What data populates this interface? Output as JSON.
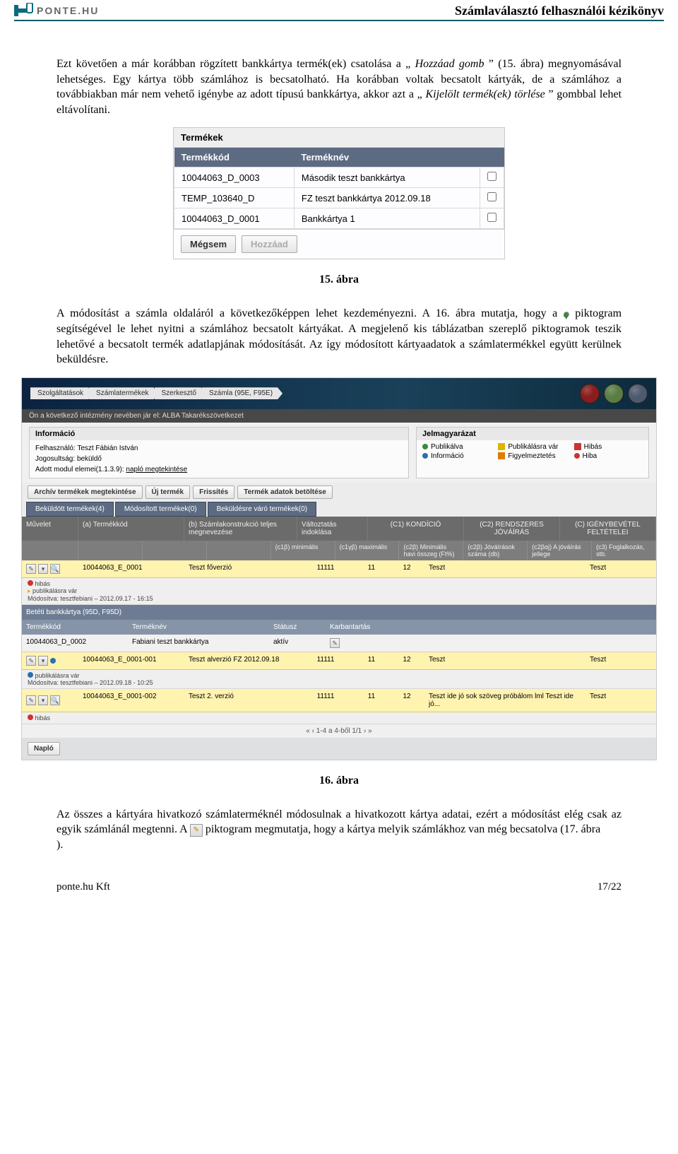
{
  "header": {
    "logo_text": "PONTE.HU",
    "doc_title": "Számlaválasztó felhasználói kézikönyv"
  },
  "para1_a": "Ezt követően a már korábban rögzített bankkártya termék(ek) csatolása a „",
  "para1_italic": "Hozzáad gomb",
  "para1_b": "” (15. ábra) megnyomásával lehetséges. Egy kártya több számlához is becsatolható. Ha korábban voltak becsatolt kártyák, de a számlához a továbbiakban már nem vehető igénybe az adott típusú bankkártya, akkor azt a „",
  "para1_italic2": "Kijelölt termék(ek) törlése",
  "para1_c": "” gombbal lehet eltávolítani.",
  "termekek": {
    "title": "Termékek",
    "col_code": "Termékkód",
    "col_name": "Terméknév",
    "rows": [
      {
        "code": "10044063_D_0003",
        "name": "Második teszt bankkártya"
      },
      {
        "code": "TEMP_103640_D",
        "name": "FZ teszt bankkártya 2012.09.18"
      },
      {
        "code": "10044063_D_0001",
        "name": "Bankkártya 1"
      }
    ],
    "btn_cancel": "Mégsem",
    "btn_add": "Hozzáad"
  },
  "fig15": "15. ábra",
  "para2_a": "A módosítást a számla oldaláról a következőképpen lehet kezdeményezni. A 16. ábra mutatja, hogy a ",
  "para2_b": " piktogram segítségével le lehet nyitni a számlához becsatolt kártyákat. A megjelenő kis táblázatban szereplő piktogramok teszik lehetővé a becsatolt termék adatlapjának módosítását. Az így módosított kártyaadatok a számlatermékkel együtt kerülnek beküldésre.",
  "app": {
    "breadcrumbs": [
      "Szolgáltatások",
      "Számlatermékek",
      "Szerkesztő",
      "Számla (95E, F95E)"
    ],
    "sub_banner": "Ön a következő intézmény nevében jár el: ALBA Takarékszövetkezet",
    "info_head": "Információ",
    "info_user_label": "Felhasználó:",
    "info_user": "Teszt Fábián István",
    "info_role_label": "Jogosultság:",
    "info_role": "beküldő",
    "info_module_label": "Adott modul elemei(1.1.3.9):",
    "info_module_link": "napló megtekintése",
    "legend_head": "Jelmagyarázat",
    "legend": [
      {
        "color": "#3a8a3a",
        "label": "Publikálva"
      },
      {
        "color": "#e0b400",
        "shape": "flag",
        "label": "Publikálásra vár"
      },
      {
        "color": "#c33",
        "shape": "flag",
        "label": "Hibás"
      },
      {
        "color": "#2a6fb5",
        "label": "Információ"
      },
      {
        "color": "#e07b00",
        "shape": "tri",
        "label": "Figyelmeztetés"
      },
      {
        "color": "#c33",
        "label": "Hiba"
      }
    ],
    "action_buttons": [
      "Archív termékek megtekintése",
      "Új termék",
      "Frissítés",
      "Termék adatok betöltése"
    ],
    "tabs": [
      "Beküldött termékek(4)",
      "Módosított termékek(0)",
      "Beküldésre váró termékek(0)"
    ],
    "grid_head1": {
      "muvelet": "Művelet",
      "a": "(a) Termékkód",
      "b": "(b) Számlakonstrukció teljes megnevezése",
      "valt": "Változtatás indoklása",
      "group1": "(C1) KONDÍCIÓ",
      "group2": "(C2) RENDSZERES JÓVÁÍRÁS",
      "group3": "(C) IGÉNYBEVÉTEL FELTÉTELEI"
    },
    "grid_head2": [
      "(c1β) minimális",
      "(c1γβ) maximális",
      "(c2β) Minimális havi összeg (Ft%)",
      "(c2β) Jóváírások száma (db)",
      "(c2βαj) A jóváírás jellege",
      "(c3) Foglalkozás, stb."
    ],
    "products": [
      {
        "code": "10044063_E_0001",
        "name": "Teszt főverzió",
        "v": "11111",
        "n1": "11",
        "n2": "12",
        "t1": "Teszt",
        "t2": "Teszt",
        "status": "hibás",
        "status_color": "#c33",
        "status2": "publikálásra vár",
        "status_note": "Módosítva: tesztfebiani – 2012.09.17 - 16:15"
      }
    ],
    "sub_header": "Betéti bankkártya (95D, F95D)",
    "sub_cols": [
      "Termékkód",
      "Terméknév",
      "Státusz",
      "Karbantartás"
    ],
    "sub_row": {
      "code": "10044063_D_0002",
      "name": "Fabiani teszt bankkártya",
      "status": "aktív"
    },
    "products2": [
      {
        "code": "10044063_E_0001-001",
        "name": "Teszt alverzió FZ 2012.09.18",
        "v": "11111",
        "n1": "11",
        "n2": "12",
        "t1": "Teszt",
        "t2": "Teszt",
        "status": "publikálásra vár",
        "status_color": "#e0b400",
        "status_note": "Módosítva: tesztfebiani – 2012.09.18 - 10:25"
      },
      {
        "code": "10044063_E_0001-002",
        "name": "Teszt 2. verzió",
        "v": "11111",
        "n1": "11",
        "n2": "12",
        "t1": "Teszt ide jó sok szöveg próbálom lml Teszt ide jó...",
        "t2": "Teszt",
        "status": "hibás",
        "status_color": "#c33"
      }
    ],
    "pager": "1-4 a 4-ből   1/1",
    "naplo": "Napló"
  },
  "fig16": "16. ábra",
  "para3_a": "Az összes a kártyára hivatkozó számlaterméknél módosulnak a hivatkozott kártya adatai, ezért a módosítást elég csak az egyik számlánál megtenni. A ",
  "para3_b": " piktogram megmutatja, hogy a kártya melyik számlákhoz van még becsatolva (17. ábra",
  "para3_c": ").",
  "footer": {
    "left": "ponte.hu Kft",
    "right": "17/22"
  }
}
